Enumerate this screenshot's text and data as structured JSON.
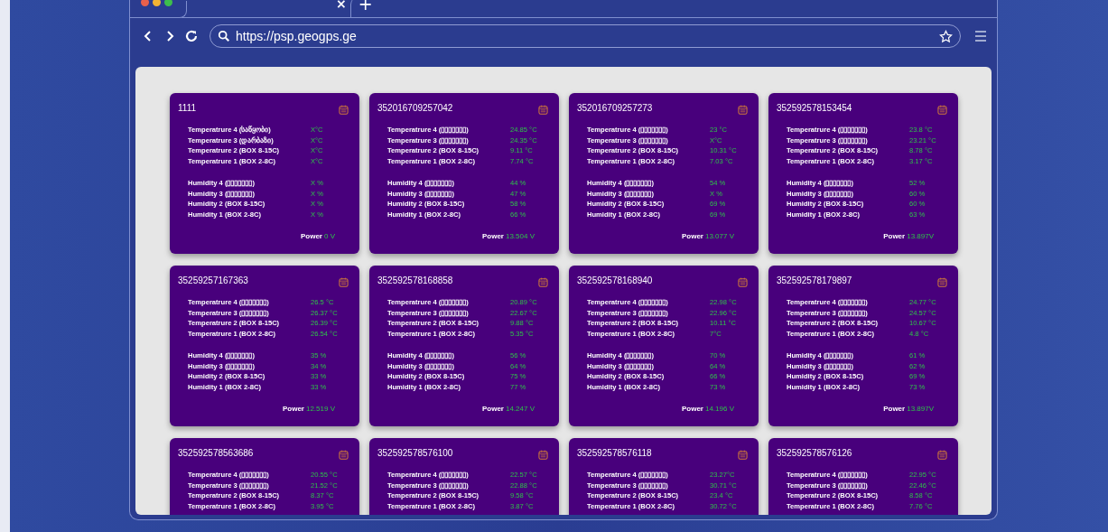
{
  "browser": {
    "tab_close": "×",
    "new_tab": "+",
    "url": "https://psp.geogps.ge"
  },
  "cards": [
    {
      "id": "1111",
      "temperatures": [
        {
          "label": "Temperatrure 4 (საწყობი)",
          "value": "X°C"
        },
        {
          "label": "Temperatrure 3 (დარბაზი)",
          "value": "X°C"
        },
        {
          "label": "Temperatrure 2 (BOX 8-15C)",
          "value": "X°C"
        },
        {
          "label": "Temperatrure 1 (BOX 2-8C)",
          "value": "X°C"
        }
      ],
      "humidities": [
        {
          "label": "Humidity 4  (▯▯▯▯▯▯▯)",
          "value": "X %"
        },
        {
          "label": "Humidity 3  (▯▯▯▯▯▯▯)",
          "value": "X %"
        },
        {
          "label": "Humidity 2  (BOX 8-15C)",
          "value": "X %"
        },
        {
          "label": "Humidity 1  (BOX 2-8C)",
          "value": "X %"
        }
      ],
      "power_label": "Power",
      "power": "0 V"
    },
    {
      "id": "352016709257042",
      "temperatures": [
        {
          "label": "Temperatrure 4 (▯▯▯▯▯▯▯)",
          "value": "24.85 °C"
        },
        {
          "label": "Temperatrure 3 (▯▯▯▯▯▯▯)",
          "value": "24.35 °C"
        },
        {
          "label": "Temperatrure 2 (BOX 8-15C)",
          "value": "9.11 °C"
        },
        {
          "label": "Temperatrure 1 (BOX 2-8C)",
          "value": "7.74 °C"
        }
      ],
      "humidities": [
        {
          "label": "Humidity 4  (▯▯▯▯▯▯▯)",
          "value": "44 %"
        },
        {
          "label": "Humidity 3  (▯▯▯▯▯▯▯)",
          "value": "47 %"
        },
        {
          "label": "Humidity 2  (BOX 8-15C)",
          "value": "58 %"
        },
        {
          "label": "Humidity 1  (BOX 2-8C)",
          "value": "66 %"
        }
      ],
      "power_label": "Power",
      "power": "13.504 V"
    },
    {
      "id": "352016709257273",
      "temperatures": [
        {
          "label": "Temperatrure 4 (▯▯▯▯▯▯▯)",
          "value": "23 °C"
        },
        {
          "label": "Temperatrure 3 (▯▯▯▯▯▯▯)",
          "value": "X°C"
        },
        {
          "label": "Temperatrure 2 (BOX 8-15C)",
          "value": "10.31 °C"
        },
        {
          "label": "Temperatrure 1 (BOX 2-8C)",
          "value": "7.03 °C"
        }
      ],
      "humidities": [
        {
          "label": "Humidity 4  (▯▯▯▯▯▯▯)",
          "value": "54 %"
        },
        {
          "label": "Humidity 3  (▯▯▯▯▯▯▯)",
          "value": "X %"
        },
        {
          "label": "Humidity 2  (BOX 8-15C)",
          "value": "69 %"
        },
        {
          "label": "Humidity 1  (BOX 2-8C)",
          "value": "69 %"
        }
      ],
      "power_label": "Power",
      "power": "13.077 V"
    },
    {
      "id": "352592578153454",
      "temperatures": [
        {
          "label": "Temperatrure 4 (▯▯▯▯▯▯▯)",
          "value": "23.8 °C"
        },
        {
          "label": "Temperatrure 3 (▯▯▯▯▯▯▯)",
          "value": "23.21 °C"
        },
        {
          "label": "Temperatrure 2 (BOX 8-15C)",
          "value": "8.78 °C"
        },
        {
          "label": "Temperatrure 1 (BOX 2-8C)",
          "value": "3.17 °C"
        }
      ],
      "humidities": [
        {
          "label": "Humidity 4  (▯▯▯▯▯▯▯)",
          "value": "52 %"
        },
        {
          "label": "Humidity 3  (▯▯▯▯▯▯▯)",
          "value": "60 %"
        },
        {
          "label": "Humidity 2  (BOX 8-15C)",
          "value": "60 %"
        },
        {
          "label": "Humidity 1  (BOX 2-8C)",
          "value": "63 %"
        }
      ],
      "power_label": "Power",
      "power": "13.897V"
    },
    {
      "id": "35259257167363",
      "temperatures": [
        {
          "label": "Temperatrure 4 (▯▯▯▯▯▯▯)",
          "value": "26.5 °C"
        },
        {
          "label": "Temperatrure 3 (▯▯▯▯▯▯▯)",
          "value": "26.37 °C"
        },
        {
          "label": "Temperatrure 2 (BOX 8-15C)",
          "value": "26.39 °C"
        },
        {
          "label": "Temperatrure 1 (BOX 2-8C)",
          "value": "26.54 °C"
        }
      ],
      "humidities": [
        {
          "label": "Humidity 4  (▯▯▯▯▯▯▯)",
          "value": "35 %"
        },
        {
          "label": "Humidity 3  (▯▯▯▯▯▯▯)",
          "value": "34 %"
        },
        {
          "label": "Humidity 2  (BOX 8-15C)",
          "value": "33 %"
        },
        {
          "label": "Humidity 1  (BOX 2-8C)",
          "value": "33 %"
        }
      ],
      "power_label": "Power",
      "power": "12.519 V"
    },
    {
      "id": "352592578168858",
      "temperatures": [
        {
          "label": "Temperatrure 4 (▯▯▯▯▯▯▯)",
          "value": "20.89 °C"
        },
        {
          "label": "Temperatrure 3 (▯▯▯▯▯▯▯)",
          "value": "22.67 °C"
        },
        {
          "label": "Temperatrure 2 (BOX 8-15C)",
          "value": "9.88 °C"
        },
        {
          "label": "Temperatrure 1 (BOX 2-8C)",
          "value": "5.35 °C"
        }
      ],
      "humidities": [
        {
          "label": "Humidity 4  (▯▯▯▯▯▯▯)",
          "value": "56 %"
        },
        {
          "label": "Humidity 3  (▯▯▯▯▯▯▯)",
          "value": "64 %"
        },
        {
          "label": "Humidity 2  (BOX 8-15C)",
          "value": "75 %"
        },
        {
          "label": "Humidity 1  (BOX 2-8C)",
          "value": "77 %"
        }
      ],
      "power_label": "Power",
      "power": "14.247 V"
    },
    {
      "id": "352592578168940",
      "temperatures": [
        {
          "label": "Temperatrure 4 (▯▯▯▯▯▯▯)",
          "value": "22.98 °C"
        },
        {
          "label": "Temperatrure 3 (▯▯▯▯▯▯▯)",
          "value": "22.96 °C"
        },
        {
          "label": "Temperatrure 2 (BOX 8-15C)",
          "value": "10.11 °C"
        },
        {
          "label": "Temperatrure 1 (BOX 2-8C)",
          "value": "7°C"
        }
      ],
      "humidities": [
        {
          "label": "Humidity 4  (▯▯▯▯▯▯▯)",
          "value": "70 %"
        },
        {
          "label": "Humidity 3  (▯▯▯▯▯▯▯)",
          "value": "64 %"
        },
        {
          "label": "Humidity 2  (BOX 8-15C)",
          "value": "66 %"
        },
        {
          "label": "Humidity 1  (BOX 2-8C)",
          "value": "73 %"
        }
      ],
      "power_label": "Power",
      "power": "14.196 V"
    },
    {
      "id": "352592578179897",
      "temperatures": [
        {
          "label": "Temperatrure 4 (▯▯▯▯▯▯▯)",
          "value": "24.77 °C"
        },
        {
          "label": "Temperatrure 3 (▯▯▯▯▯▯▯)",
          "value": "24.57 °C"
        },
        {
          "label": "Temperatrure 2 (BOX 8-15C)",
          "value": "10.67 °C"
        },
        {
          "label": "Temperatrure 1 (BOX 2-8C)",
          "value": "4.8 °C"
        }
      ],
      "humidities": [
        {
          "label": "Humidity 4  (▯▯▯▯▯▯▯)",
          "value": "61 %"
        },
        {
          "label": "Humidity 3  (▯▯▯▯▯▯▯)",
          "value": "62 %"
        },
        {
          "label": "Humidity 2  (BOX 8-15C)",
          "value": "69 %"
        },
        {
          "label": "Humidity 1  (BOX 2-8C)",
          "value": "73 %"
        }
      ],
      "power_label": "Power",
      "power": "13.897V"
    },
    {
      "id": "352592578563686",
      "temperatures": [
        {
          "label": "Temperatrure 4 (▯▯▯▯▯▯▯)",
          "value": "20.55 °C"
        },
        {
          "label": "Temperatrure 3 (▯▯▯▯▯▯▯)",
          "value": "21.52 °C"
        },
        {
          "label": "Temperatrure 2 (BOX 8-15C)",
          "value": "8.37 °C"
        },
        {
          "label": "Temperatrure 1 (BOX 2-8C)",
          "value": "3.95 °C"
        }
      ]
    },
    {
      "id": "352592578576100",
      "temperatures": [
        {
          "label": "Temperatrure 4 (▯▯▯▯▯▯▯)",
          "value": "22.57 °C"
        },
        {
          "label": "Temperatrure 3 (▯▯▯▯▯▯▯)",
          "value": "22.88 °C"
        },
        {
          "label": "Temperatrure 2 (BOX 8-15C)",
          "value": "9.58 °C"
        },
        {
          "label": "Temperatrure 1 (BOX 2-8C)",
          "value": "3.87 °C"
        }
      ]
    },
    {
      "id": "352592578576118",
      "temperatures": [
        {
          "label": "Temperatrure 4 (▯▯▯▯▯▯▯)",
          "value": "23.27°C"
        },
        {
          "label": "Temperatrure 3 (▯▯▯▯▯▯▯)",
          "value": "30.71 °C"
        },
        {
          "label": "Temperatrure 2 (BOX 8-15C)",
          "value": "23.4 °C"
        },
        {
          "label": "Temperatrure 1 (BOX 2-8C)",
          "value": "30.72 °C"
        }
      ]
    },
    {
      "id": "352592578576126",
      "temperatures": [
        {
          "label": "Temperatrure 4 (▯▯▯▯▯▯▯)",
          "value": "22.95 °C"
        },
        {
          "label": "Temperatrure 3 (▯▯▯▯▯▯▯)",
          "value": "22.46 °C"
        },
        {
          "label": "Temperatrure 2 (BOX 8-15C)",
          "value": "8.58 °C"
        },
        {
          "label": "Temperatrure 1 (BOX 2-8C)",
          "value": "7.76 °C"
        }
      ]
    }
  ]
}
